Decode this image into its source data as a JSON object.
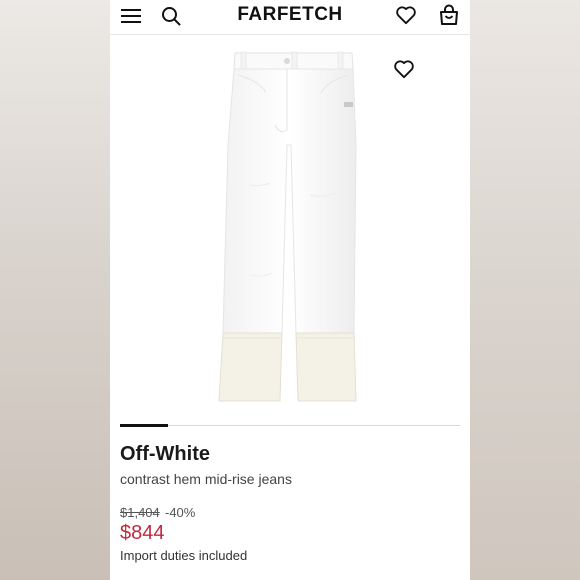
{
  "header": {
    "brand": "FARFETCH",
    "icons": [
      "menu-icon",
      "search-icon",
      "heart-icon",
      "shopping-bag-icon"
    ]
  },
  "product": {
    "image": "white jeans with contrast hem",
    "favorite_icon": "heart-icon",
    "designer": "Off-White",
    "name": "contrast hem mid-rise jeans",
    "original_price": "$1,404",
    "discount": "-40%",
    "price": "$844",
    "duties_note": "Import duties included"
  },
  "carousel": {
    "active_index": 0
  },
  "colors": {
    "sale_price": "#c2293f",
    "text": "#1a1a1a",
    "background": "#ffffff"
  }
}
